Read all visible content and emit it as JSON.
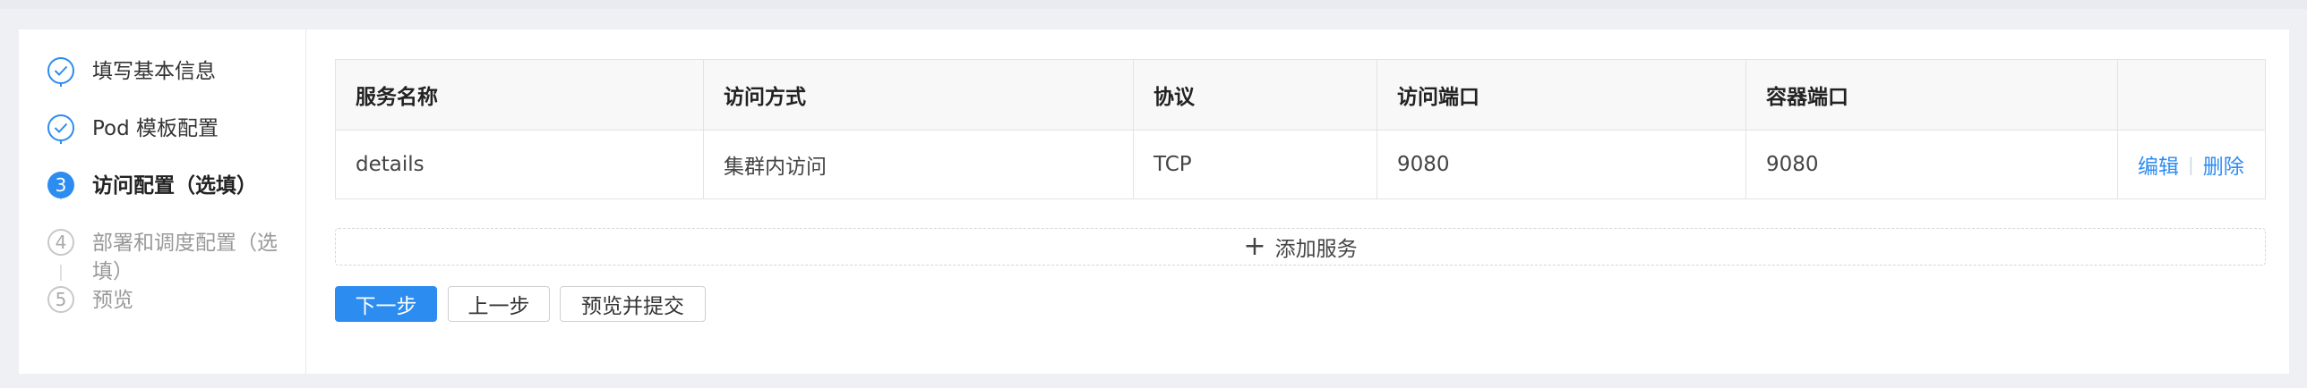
{
  "steps": [
    {
      "label": "填写基本信息",
      "state": "done"
    },
    {
      "label": "Pod 模板配置",
      "state": "done"
    },
    {
      "number": "3",
      "label": "访问配置（选填）",
      "state": "active"
    },
    {
      "number": "4",
      "label": "部署和调度配置（选填）",
      "state": "todo"
    },
    {
      "number": "5",
      "label": "预览",
      "state": "todo"
    }
  ],
  "table": {
    "headers": [
      "服务名称",
      "访问方式",
      "协议",
      "访问端口",
      "容器端口",
      ""
    ],
    "rows": [
      {
        "name": "details",
        "access": "集群内访问",
        "protocol": "TCP",
        "port": "9080",
        "target_port": "9080",
        "edit": "编辑",
        "delete": "删除"
      }
    ]
  },
  "add_service": {
    "label": "添加服务"
  },
  "buttons": {
    "next": "下一步",
    "prev": "上一步",
    "preview_submit": "预览并提交"
  },
  "colors": {
    "accent": "#2d8cf0",
    "background": "#eef0f4",
    "border": "#e3e3e3"
  }
}
